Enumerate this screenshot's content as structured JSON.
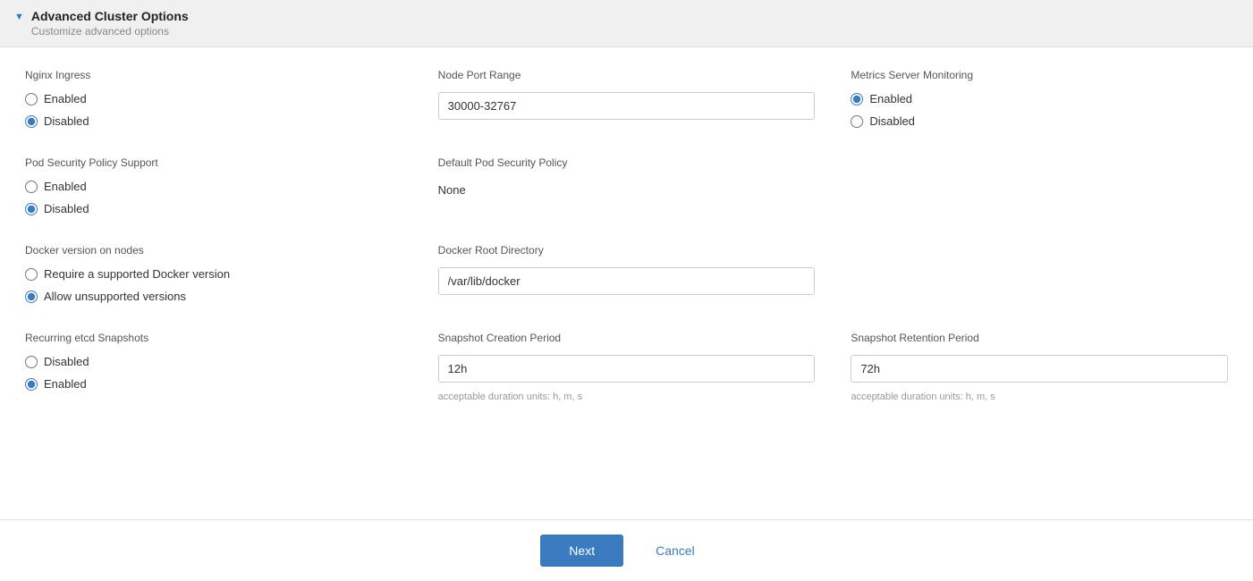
{
  "panel": {
    "title": "Advanced Cluster Options",
    "subtitle": "Customize advanced options",
    "chevron": "▼"
  },
  "sections": {
    "nginx_ingress": {
      "label": "Nginx Ingress",
      "options": [
        {
          "id": "nginx-enabled",
          "label": "Enabled",
          "checked": false
        },
        {
          "id": "nginx-disabled",
          "label": "Disabled",
          "checked": true
        }
      ]
    },
    "node_port_range": {
      "label": "Node Port Range",
      "value": "30000-32767",
      "placeholder": "30000-32767"
    },
    "metrics_server": {
      "label": "Metrics Server Monitoring",
      "options": [
        {
          "id": "metrics-enabled",
          "label": "Enabled",
          "checked": true
        },
        {
          "id": "metrics-disabled",
          "label": "Disabled",
          "checked": false
        }
      ]
    },
    "pod_security_policy": {
      "label": "Pod Security Policy Support",
      "options": [
        {
          "id": "psp-enabled",
          "label": "Enabled",
          "checked": false
        },
        {
          "id": "psp-disabled",
          "label": "Disabled",
          "checked": true
        }
      ]
    },
    "default_pod_security": {
      "label": "Default Pod Security Policy",
      "value": "None"
    },
    "docker_version": {
      "label": "Docker version on nodes",
      "options": [
        {
          "id": "docker-supported",
          "label": "Require a supported Docker version",
          "checked": false
        },
        {
          "id": "docker-unsupported",
          "label": "Allow unsupported versions",
          "checked": true
        }
      ]
    },
    "docker_root": {
      "label": "Docker Root Directory",
      "value": "/var/lib/docker",
      "placeholder": "/var/lib/docker"
    },
    "recurring_etcd": {
      "label": "Recurring etcd Snapshots",
      "options": [
        {
          "id": "etcd-disabled",
          "label": "Disabled",
          "checked": false
        },
        {
          "id": "etcd-enabled",
          "label": "Enabled",
          "checked": true
        }
      ]
    },
    "snapshot_creation": {
      "label": "Snapshot Creation Period",
      "value": "12h",
      "hint": "acceptable duration units: h, m, s"
    },
    "snapshot_retention": {
      "label": "Snapshot Retention Period",
      "value": "72h",
      "hint": "acceptable duration units: h, m, s"
    }
  },
  "footer": {
    "next_label": "Next",
    "cancel_label": "Cancel"
  }
}
